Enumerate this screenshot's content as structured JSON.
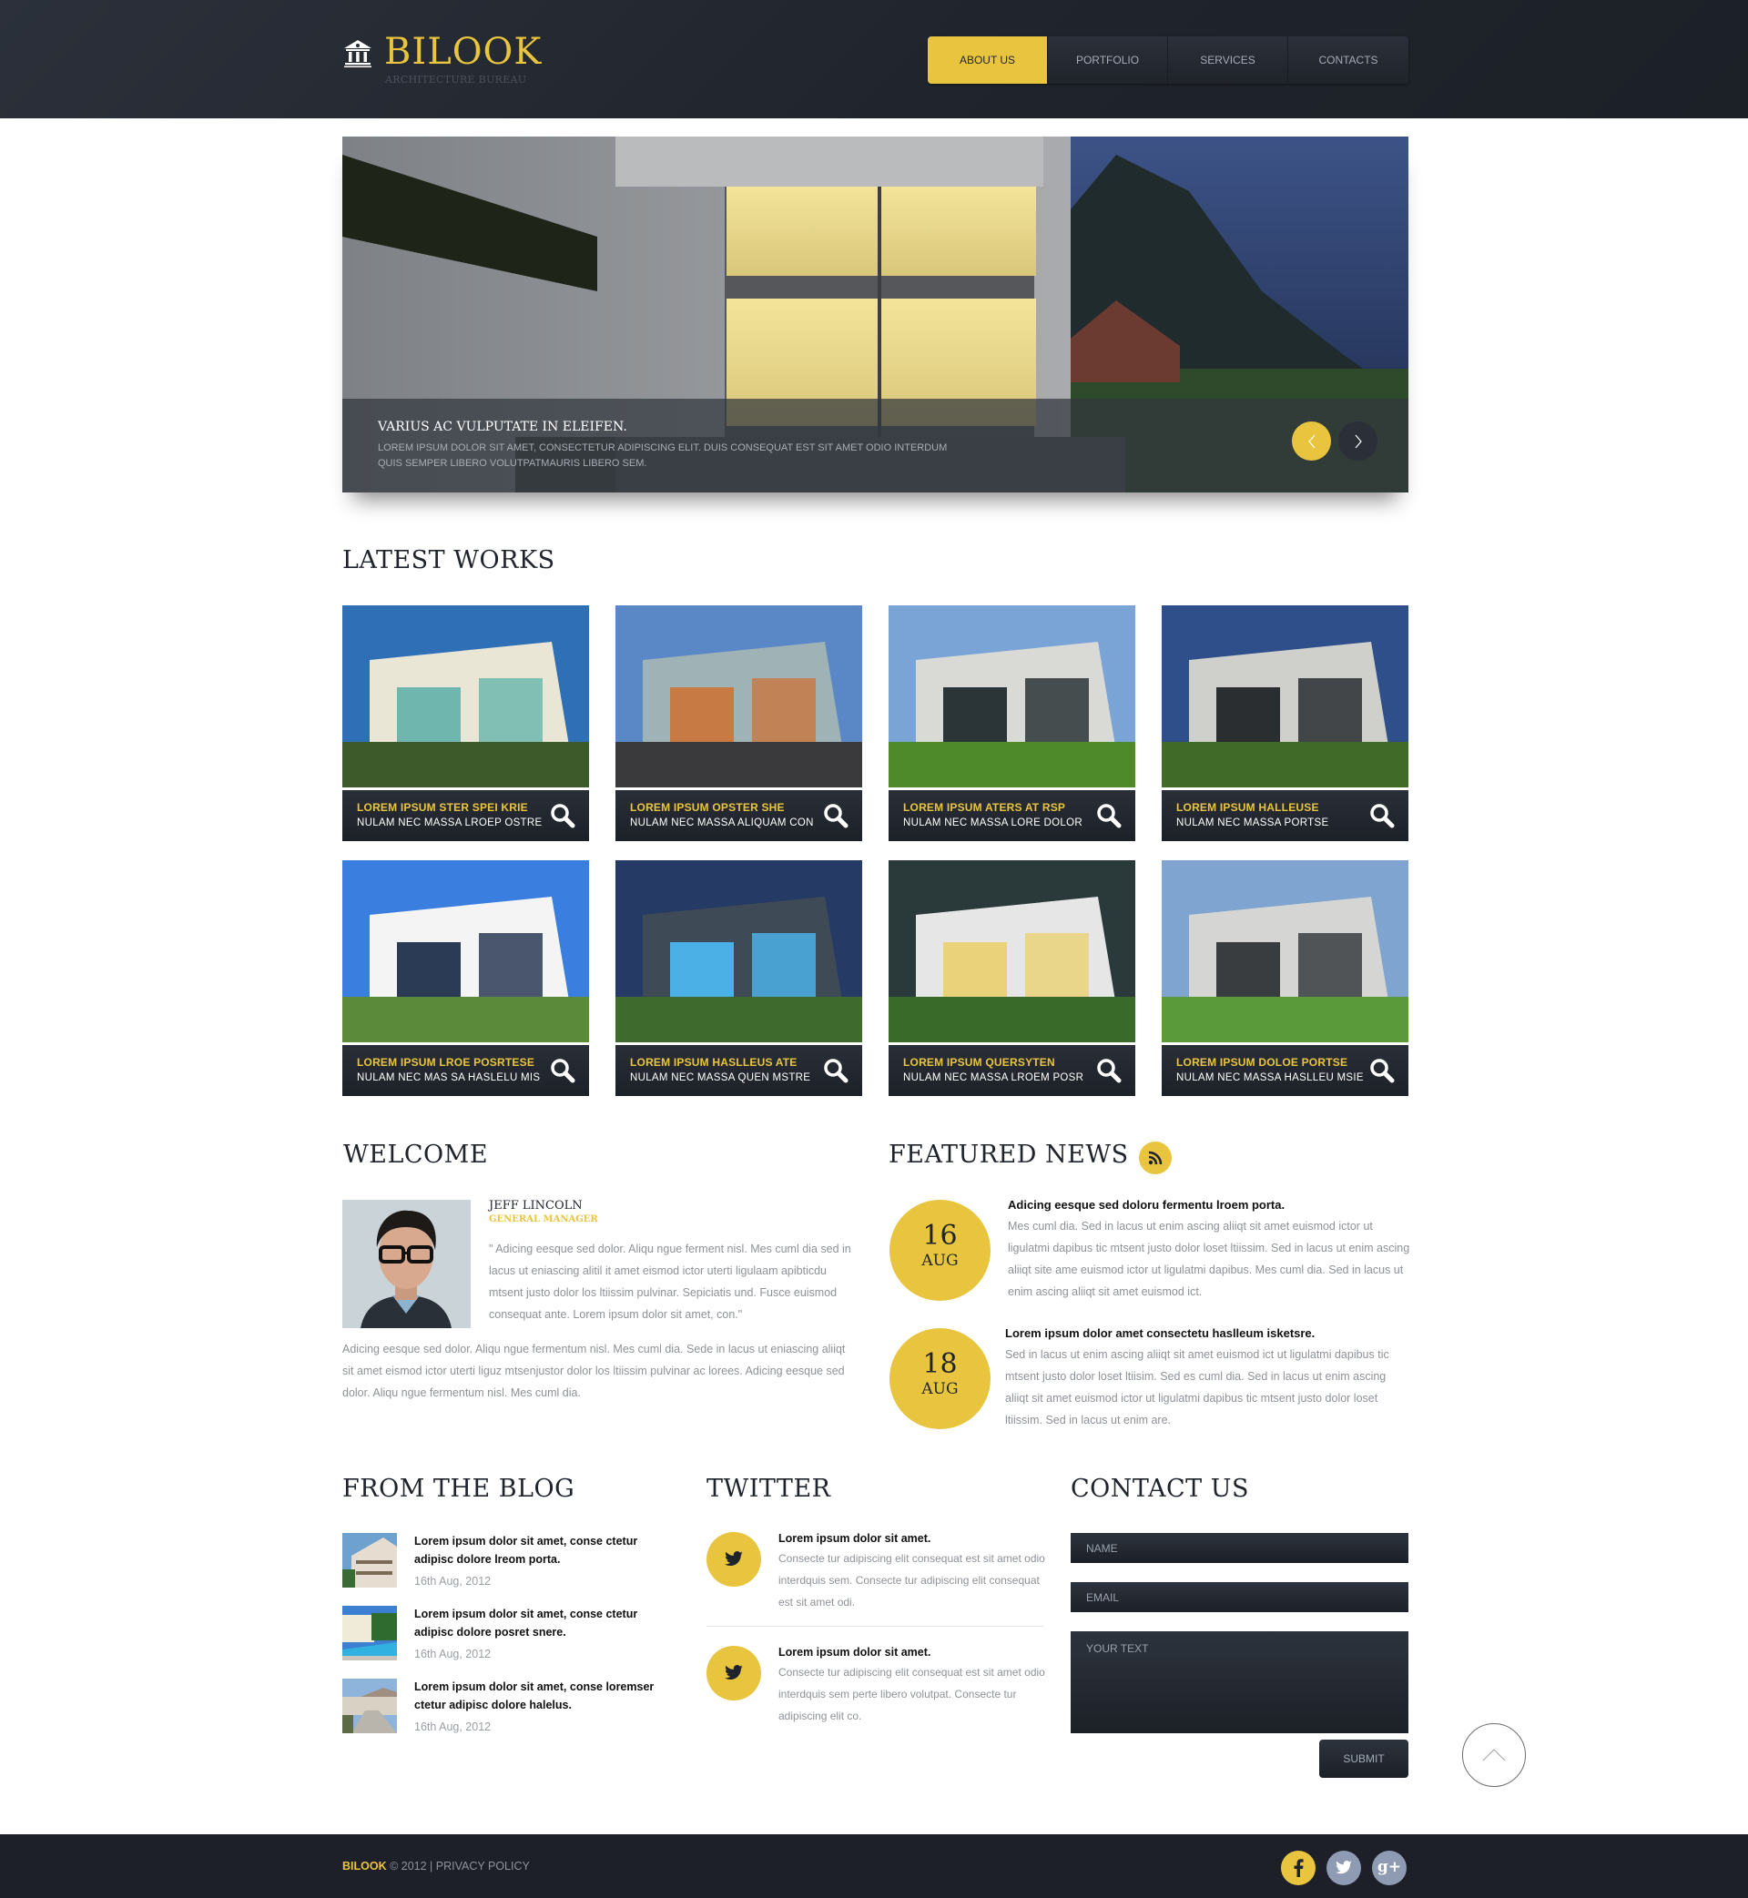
{
  "brand": {
    "name": "BILOOK",
    "tagline": "ARCHITECTURE BUREAU",
    "accent_color": "#e9c53f",
    "dark_color": "#1f232b"
  },
  "nav": {
    "items": [
      {
        "label": "ABOUT US",
        "active": true
      },
      {
        "label": "PORTFOLIO",
        "active": false
      },
      {
        "label": "SERVICES",
        "active": false
      },
      {
        "label": "CONTACTS",
        "active": false
      }
    ]
  },
  "slider": {
    "title": "VARIUS AC VULPUTATE IN ELEIFEN.",
    "text": "LOREM IPSUM DOLOR SIT AMET, CONSECTETUR ADIPISCING ELIT. DUIS CONSEQUAT EST SIT AMET ODIO INTERDUM QUIS SEMPER LIBERO VOLUTPATMAURIS LIBERO SEM.",
    "prev_icon": "chevron-left-icon",
    "next_icon": "chevron-right-icon"
  },
  "latest_works": {
    "heading": "LATEST WORKS",
    "items": [
      {
        "title": "LOREM IPSUM STER SPEI KRIE",
        "subtitle": "NULAM NEC MASSA LROEP OSTRE"
      },
      {
        "title": "LOREM IPSUM OPSTER SHE",
        "subtitle": "NULAM NEC MASSA ALIQUAM CON"
      },
      {
        "title": "LOREM IPSUM ATERS AT RSP",
        "subtitle": "NULAM NEC MASSA LORE DOLOR"
      },
      {
        "title": "LOREM IPSUM HALLEUSE",
        "subtitle": "NULAM NEC MASSA PORTSE"
      },
      {
        "title": "LOREM IPSUM LROE POSRTESE",
        "subtitle": "NULAM NEC MAS SA HASLELU MIS"
      },
      {
        "title": "LOREM IPSUM HASLLEUS ATE",
        "subtitle": "NULAM NEC MASSA QUEN MSTRE"
      },
      {
        "title": "LOREM IPSUM QUERSYTEN",
        "subtitle": "NULAM NEC MASSA LROEM POSR"
      },
      {
        "title": "LOREM IPSUM DOLOE PORTSE",
        "subtitle": "NULAM NEC MASSA HASLLEU MSIE"
      }
    ]
  },
  "welcome": {
    "heading": "WELCOME",
    "name": "JEFF LINCOLN",
    "role": "GENERAL MANAGER",
    "quote": "\" Adicing eesque sed dolor. Aliqu ngue ferment nisl. Mes cuml dia sed in lacus ut eniascing alitil it amet eismod ictor uterti ligulaam apibticdu mtsent justo dolor los ltiissim pulvinar. Sepiciatis und. Fusce euismod consequat ante. Lorem ipsum dolor sit amet, con.\"",
    "text": "Adicing eesque sed dolor. Aliqu ngue fermentum nisl. Mes cuml dia. Sede in lacus ut eniascing aliiqt sit amet eismod ictor uterti liguz mtsenjustor dolor los ltiissim pulvinar ac lorees. Adicing eesque sed dolor. Aliqu ngue fermentum nisl. Mes cuml dia."
  },
  "featured_news": {
    "heading": "FEATURED NEWS",
    "items": [
      {
        "day": "16",
        "month": "AUG",
        "title": "Adicing eesque sed doloru fermentu lroem porta.",
        "text": "Mes cuml dia. Sed in lacus ut enim ascing aliiqt sit amet euismod ictor ut ligulatmi dapibus tic mtsent justo dolor loset ltiissim. Sed in lacus ut enim ascing aliiqt site ame euismod ictor ut ligulatmi dapibus. Mes cuml dia. Sed in lacus ut enim ascing aliiqt sit amet euismod ict."
      },
      {
        "day": "18",
        "month": "AUG",
        "title": "Lorem ipsum dolor amet consectetu haslleum isketsre.",
        "text": "Sed in lacus ut enim ascing aliiqt sit amet euismod ict ut ligulatmi dapibus tic mtsent justo dolor loset ltiisim. Sed es cuml dia. Sed in lacus ut enim ascing aliiqt sit amet euismod ictor ut ligulatmi dapibus tic mtsent justo dolor loset ltiissim. Sed in lacus ut enim are."
      }
    ]
  },
  "blog": {
    "heading": "FROM THE BLOG",
    "items": [
      {
        "title": "Lorem ipsum dolor sit amet, conse ctetur adipisc dolore lreom porta.",
        "date": "16th Aug, 2012"
      },
      {
        "title": "Lorem ipsum dolor sit amet, conse ctetur adipisc dolore posret snere.",
        "date": "16th Aug, 2012"
      },
      {
        "title": "Lorem ipsum dolor sit amet, conse loremser ctetur adipisc dolore halelus.",
        "date": "16th Aug, 2012"
      }
    ]
  },
  "twitter": {
    "heading": "TWITTER",
    "items": [
      {
        "title": "Lorem ipsum dolor sit amet.",
        "text": "Consecte tur adipiscing elit consequat est sit amet odio interdquis sem. Consecte tur adipiscing elit consequat est sit amet odi."
      },
      {
        "title": "Lorem ipsum dolor sit amet.",
        "text": "Consecte tur adipiscing elit consequat est sit amet odio interdquis sem perte libero volutpat. Consecte tur adipiscing elit co."
      }
    ]
  },
  "contact": {
    "heading": "CONTACT US",
    "name_placeholder": "NAME",
    "email_placeholder": "EMAIL",
    "message_placeholder": "YOUR TEXT",
    "submit_label": "SUBMIT"
  },
  "footer": {
    "brand": "BILOOK",
    "copyright": " © 2012 | ",
    "privacy": "PRIVACY POLICY",
    "social": [
      "facebook-icon",
      "twitter-icon",
      "google-plus-icon"
    ]
  }
}
